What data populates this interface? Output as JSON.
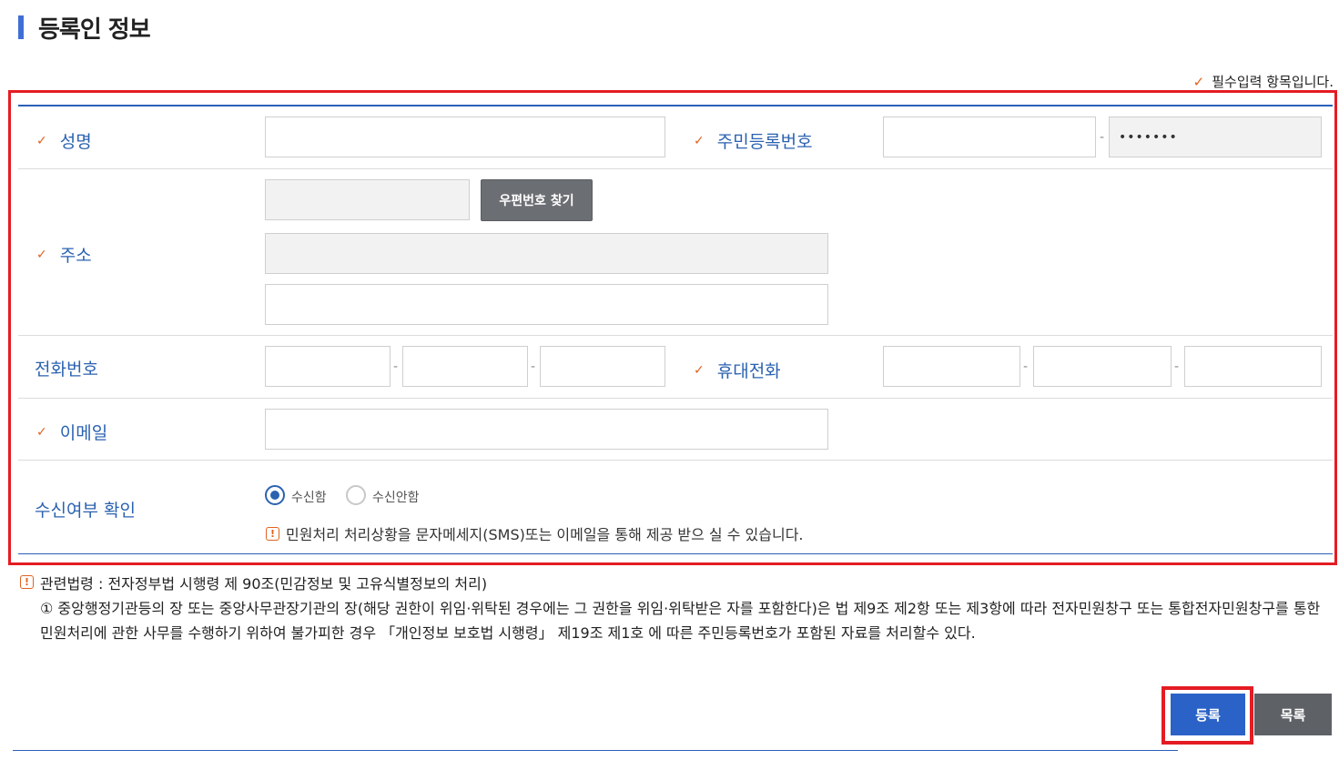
{
  "page": {
    "title": "등록인 정보"
  },
  "required_note": "필수입력 항목입니다.",
  "fields": {
    "name": {
      "label": "성명",
      "value": ""
    },
    "rrn": {
      "label": "주민등록번호",
      "first": "",
      "second": "•••••••"
    },
    "address": {
      "label": "주소",
      "zip": "",
      "addr1": "",
      "addr2": "",
      "zip_button": "우편번호 찾기"
    },
    "phone": {
      "label": "전화번호",
      "p1": "",
      "p2": "",
      "p3": ""
    },
    "mobile": {
      "label": "휴대전화",
      "m1": "",
      "m2": "",
      "m3": ""
    },
    "email": {
      "label": "이메일",
      "value": ""
    },
    "receive": {
      "label": "수신여부 확인",
      "options": [
        "수신함",
        "수신안함"
      ],
      "selected": "수신함",
      "note": "민원처리 처리상황을 문자메세지(SMS)또는 이메일을 통해 제공 받으 실 수 있습니다."
    }
  },
  "law": {
    "title": "관련법령 : 전자정부법 시행령 제 90조(민감정보 및 고유식별정보의 처리)",
    "text": "① 중앙행정기관등의 장 또는 중앙사무관장기관의 장(해당 권한이 위임·위탁된 경우에는 그 권한을 위임·위탁받은 자를 포함한다)은 법 제9조 제2항 또는 제3항에 따라 전자민원창구 또는 통합전자민원창구를 통한 민원처리에 관한 사무를 수행하기 위하여 불가피한 경우 「개인정보 보호법 시행령」 제19조 제1호 에 따른 주민등록번호가 포함된 자료를 처리할수 있다."
  },
  "buttons": {
    "submit": "등록",
    "list": "목록"
  },
  "icons": {
    "check": "✓",
    "warn": "!"
  },
  "colors": {
    "accent": "#2b62b0",
    "check": "#e0621f",
    "highlight": "#e41c23"
  }
}
